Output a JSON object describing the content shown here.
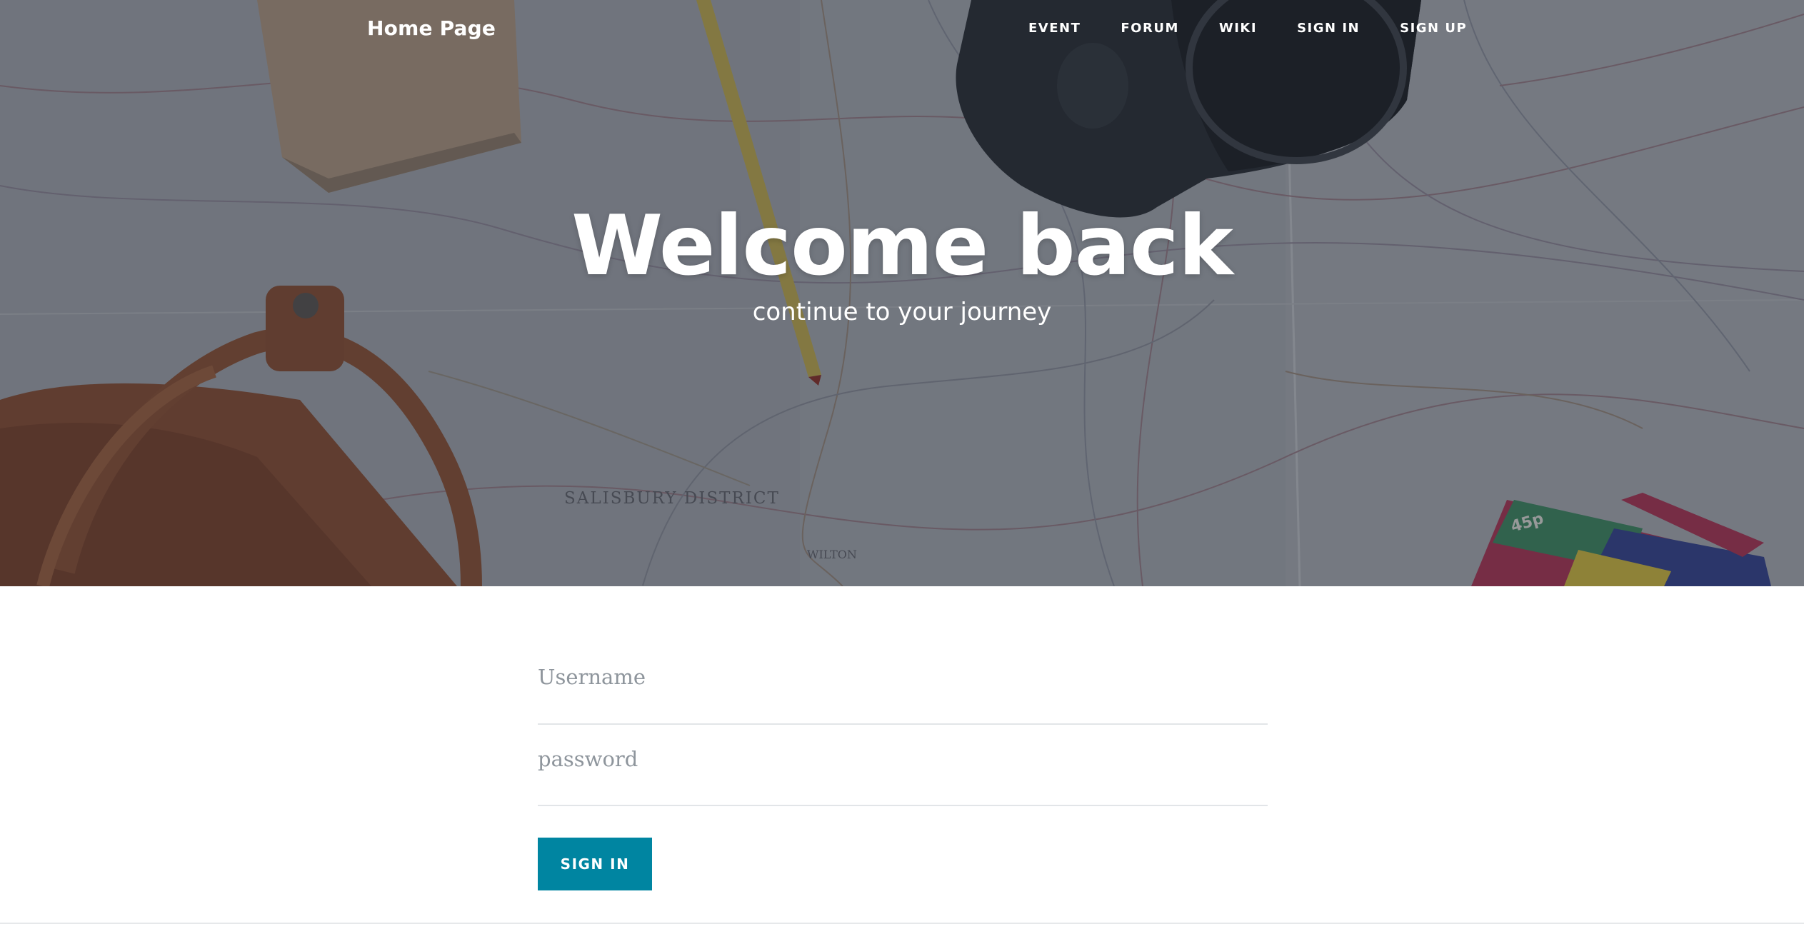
{
  "nav": {
    "brand": "Home Page",
    "links": [
      "EVENT",
      "FORUM",
      "WIKI",
      "SIGN IN",
      "SIGN UP"
    ]
  },
  "hero": {
    "title": "Welcome back",
    "subtitle": "continue to your journey",
    "map_labels": [
      "SALISBURY DISTRICT",
      "WILTON",
      "45p"
    ]
  },
  "form": {
    "username_placeholder": "Username",
    "password_placeholder": "password",
    "submit_label": "SIGN IN"
  },
  "colors": {
    "accent": "#0085a1",
    "text_on_hero": "#ffffff"
  }
}
